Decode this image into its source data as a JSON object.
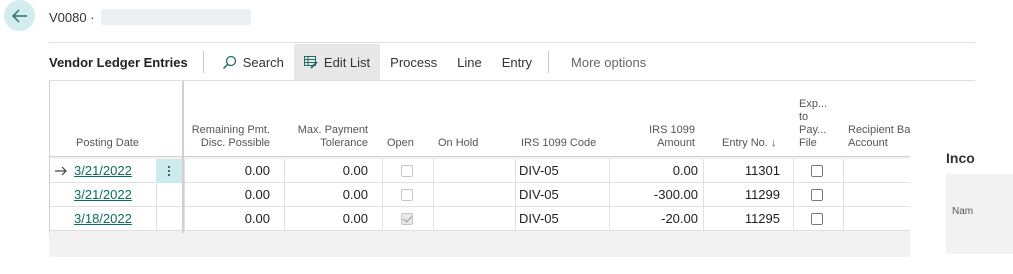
{
  "header": {
    "record_title": "V0080 ·"
  },
  "actionbar": {
    "page_caption": "Vendor Ledger Entries",
    "actions": [
      "Search",
      "Edit List",
      "Process",
      "Line",
      "Entry"
    ],
    "more": "More options"
  },
  "grid": {
    "headers": {
      "posting_date": "Posting Date",
      "remaining_pmt_disc": [
        "Remaining Pmt.",
        "Disc. Possible"
      ],
      "max_payment_tol": [
        "Max. Payment",
        "Tolerance"
      ],
      "open": "Open",
      "on_hold": "On Hold",
      "irs_code": "IRS 1099 Code",
      "irs_amount": [
        "IRS 1099",
        "Amount"
      ],
      "entry_no": "Entry No. ↓",
      "exported": [
        "Exp...",
        "to",
        "Pay...",
        "File"
      ],
      "recipient_bank": [
        "Recipient Ba",
        "Account"
      ]
    },
    "rows": [
      {
        "posting_date": "3/21/2022",
        "remaining": "0.00",
        "max_tol": "0.00",
        "open": false,
        "on_hold": "",
        "irs_code": "DIV-05",
        "irs_amount": "0.00",
        "entry_no": "11301",
        "exported": false,
        "recipient_bank": ""
      },
      {
        "posting_date": "3/21/2022",
        "remaining": "0.00",
        "max_tol": "0.00",
        "open": false,
        "on_hold": "",
        "irs_code": "DIV-05",
        "irs_amount": "-300.00",
        "entry_no": "11299",
        "exported": false,
        "recipient_bank": ""
      },
      {
        "posting_date": "3/18/2022",
        "remaining": "0.00",
        "max_tol": "0.00",
        "open": true,
        "on_hold": "",
        "irs_code": "DIV-05",
        "irs_amount": "-20.00",
        "entry_no": "11295",
        "exported": false,
        "recipient_bank": ""
      }
    ]
  },
  "side_panel": {
    "title": "Inco",
    "field_label": "Nam"
  },
  "colors": {
    "accent": "#0b6b5d",
    "back_button_bg": "#d3edee",
    "selected_row_action_bg": "#cdebed"
  }
}
